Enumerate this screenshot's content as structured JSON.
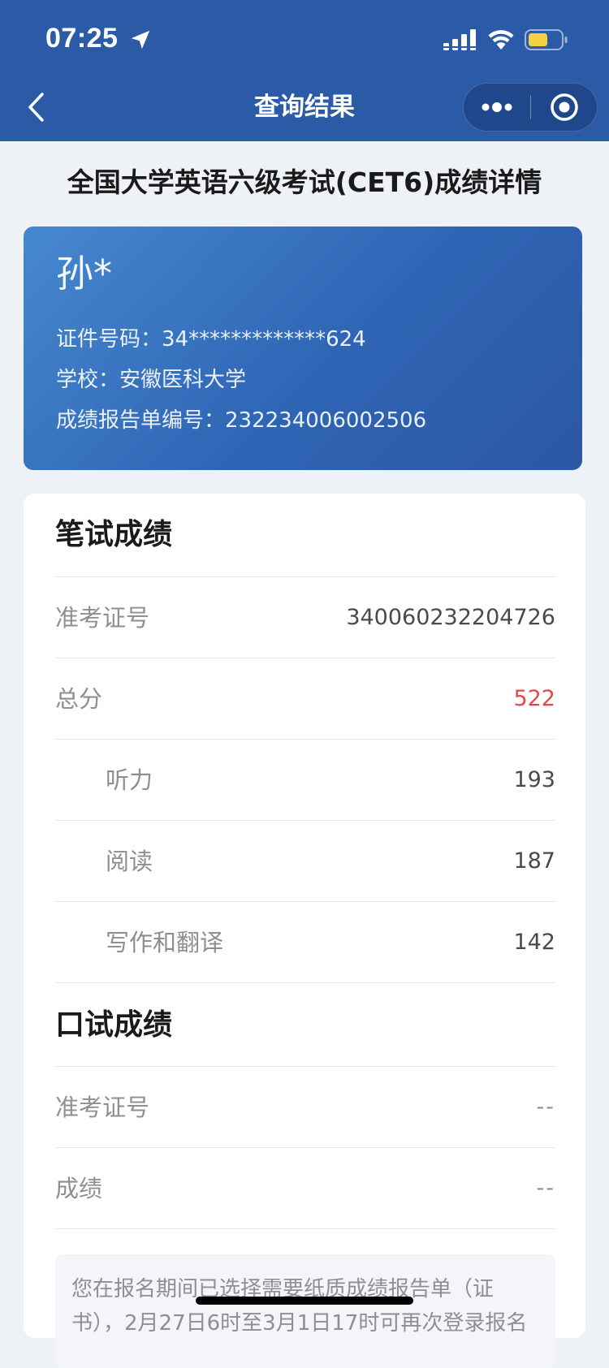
{
  "status_bar": {
    "time": "07:25",
    "icons": [
      "location-arrow-icon",
      "cellular-signal-icon",
      "wifi-icon",
      "battery-icon"
    ],
    "battery_color": "#f5d142"
  },
  "nav": {
    "title": "查询结果",
    "back_icon": "chevron-left-icon",
    "more_icon": "more-dots-icon",
    "close_icon": "target-circle-icon",
    "bar_color": "#2b5aa7"
  },
  "heading": "全国大学英语六级考试(CET6)成绩详情",
  "candidate": {
    "name": "孙*",
    "id_line": "证件号码：34*************624",
    "school_line": "学校：安徽医科大学",
    "report_line": "成绩报告单编号：232234006002506"
  },
  "written": {
    "title": "笔试成绩",
    "rows": [
      {
        "label": "准考证号",
        "value": "340060232204726"
      },
      {
        "label": "总分",
        "value": "522"
      },
      {
        "label": "听力",
        "value": "193"
      },
      {
        "label": "阅读",
        "value": "187"
      },
      {
        "label": "写作和翻译",
        "value": "142"
      }
    ]
  },
  "oral": {
    "title": "口试成绩",
    "rows": [
      {
        "label": "准考证号",
        "value": "--"
      },
      {
        "label": "成绩",
        "value": "--"
      }
    ]
  },
  "notice": "您在报名期间已选择需要纸质成绩报告单（证书），2月27日6时至3月1日17时可再次登录报名",
  "colors": {
    "accent_red": "#e0484d",
    "card_gradient_start": "#4689cf",
    "card_gradient_end": "#2a57a4"
  }
}
